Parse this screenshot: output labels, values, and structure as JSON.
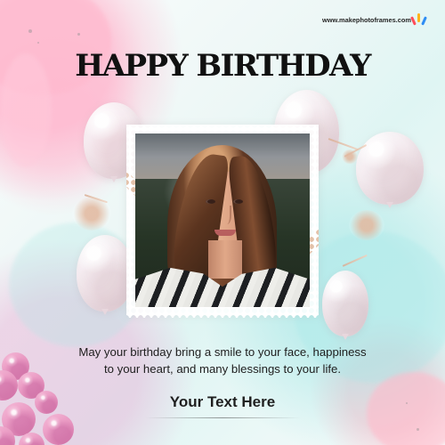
{
  "watermark": "www.makephotoframes.com",
  "title": "HAPPY BIRTHDAY",
  "message": "May your birthday bring a smile to your face, happiness\nto your heart, and many blessings to your life.",
  "custom_text": "Your Text Here",
  "colors": {
    "title": "#111111",
    "text": "#202020",
    "pink_accent": "#f0a5cb",
    "teal_wash": "#dff5f3",
    "gold_ribbon": "#d9ad93"
  },
  "icons": {
    "watermark": "colorful-logo-icon",
    "photo": "portrait-photo",
    "decoration": "balloon-icons"
  }
}
